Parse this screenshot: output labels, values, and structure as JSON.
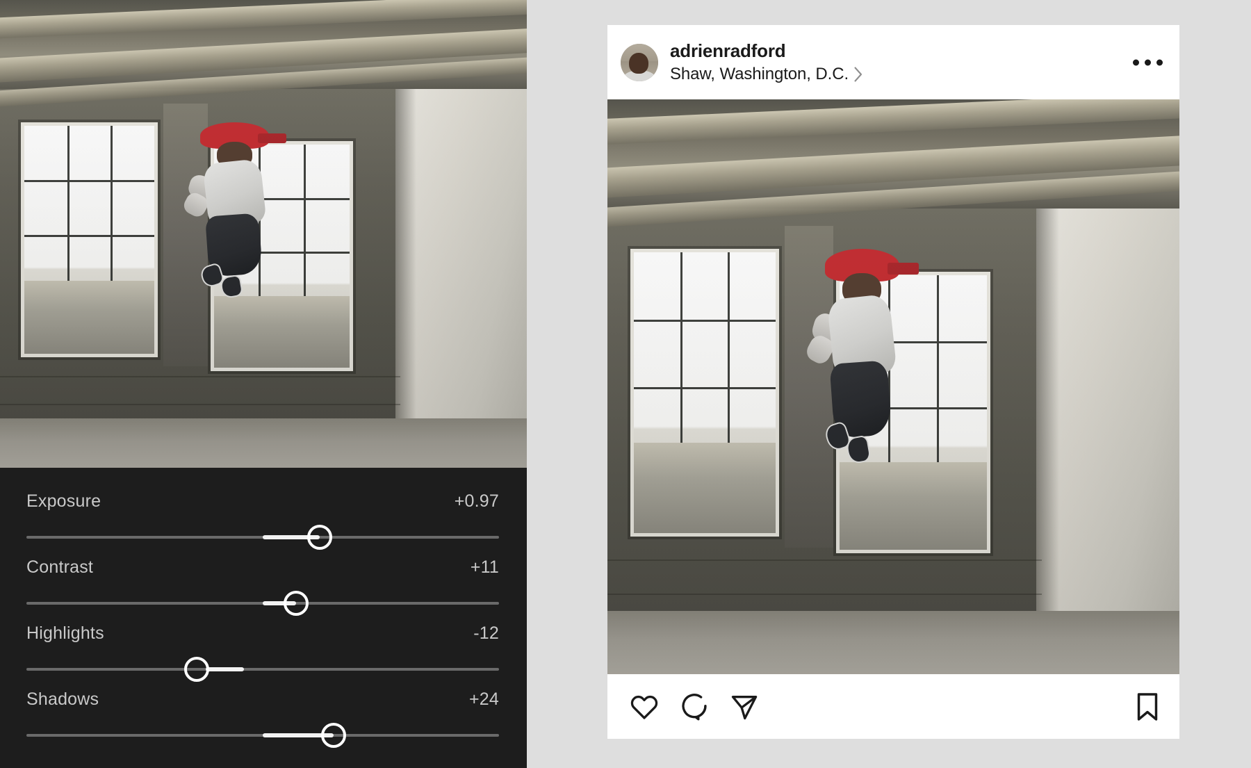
{
  "app": {
    "title": "Photo Editor — Instagram Preview",
    "background_color": "#dedede"
  },
  "editor": {
    "panel_background": "#1d1d1d",
    "label_color": "#c9c9c9",
    "track_color": "#6a6a6a",
    "fill_color": "#f2f2f2",
    "knob_color": "#ffffff",
    "sliders": [
      {
        "name": "exposure",
        "label": "Exposure",
        "value": "+0.97",
        "fill_from_pct": 50,
        "knob_pct": 62
      },
      {
        "name": "contrast",
        "label": "Contrast",
        "value": "+11",
        "fill_from_pct": 50,
        "knob_pct": 57
      },
      {
        "name": "highlights",
        "label": "Highlights",
        "value": "-12",
        "fill_from_pct": 50,
        "knob_pct": 36
      },
      {
        "name": "shadows",
        "label": "Shadows",
        "value": "+24",
        "fill_from_pct": 50,
        "knob_pct": 65
      }
    ]
  },
  "instagram": {
    "card_background": "#ffffff",
    "username": "adrienradford",
    "location": "Shaw, Washington, D.C.",
    "chevron_icon": "chevron-right-icon",
    "more_options_icon": "more-options-icon",
    "avatar_icon": "avatar",
    "actions": {
      "like_icon": "heart-icon",
      "comment_icon": "comment-bubble-icon",
      "share_icon": "share-paper-plane-icon",
      "save_icon": "bookmark-icon"
    }
  },
  "photo": {
    "subject": "Man in red cap jumping inside a loft with large industrial windows",
    "alt_editor": "Edited photo preview in editor pane",
    "alt_instagram": "Edited photo shown in Instagram post preview"
  }
}
